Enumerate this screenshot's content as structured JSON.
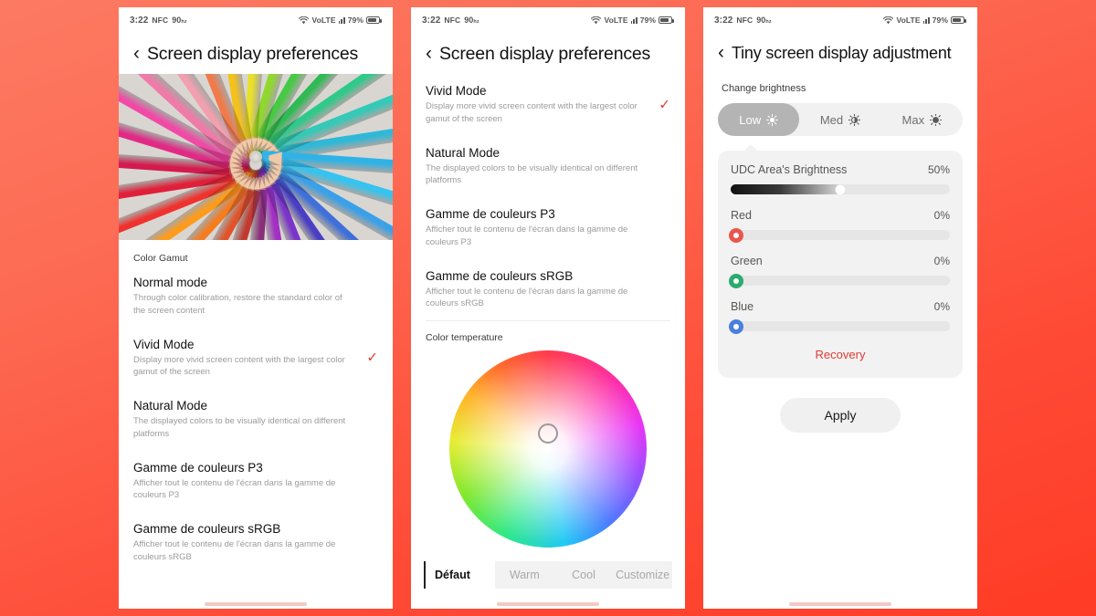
{
  "background": {
    "from": "#fd7a62",
    "to": "#ff3b25"
  },
  "accent": {
    "red": "#e23b34",
    "check": "#e23b34"
  },
  "status_bar": {
    "time": "3:22",
    "nfc": "NFC",
    "refresh_rate": "90",
    "refresh_unit": "hz",
    "wifi_icon": "wifi-icon",
    "volte": "VoLTE",
    "signal_icon": "signal-bars-icon",
    "battery_percent": "79%",
    "battery_icon": "battery-icon"
  },
  "panel1": {
    "back_icon": "back-chevron-icon",
    "title": "Screen display preferences",
    "hero_alt": "colored-pencils-radial-image",
    "section_label": "Color Gamut",
    "options": [
      {
        "title": "Normal mode",
        "sub": "Through color calibration, restore the standard color of the screen content",
        "checked": false
      },
      {
        "title": "Vivid Mode",
        "sub": "Display more vivid screen content with the largest color gamut of the screen",
        "checked": true
      },
      {
        "title": "Natural Mode",
        "sub": "The displayed colors to be visually identical on different platforms",
        "checked": false
      },
      {
        "title": "Gamme de couleurs P3",
        "sub": "Afficher tout le contenu de l'écran dans la gamme de couleurs P3",
        "checked": false
      },
      {
        "title": "Gamme de couleurs sRGB",
        "sub": "Afficher tout le contenu de l'écran dans la gamme de couleurs sRGB",
        "checked": false
      }
    ],
    "check_mark": "✓"
  },
  "panel2": {
    "back_icon": "back-chevron-icon",
    "title": "Screen display preferences",
    "options": [
      {
        "title": "Vivid Mode",
        "sub": "Display more vivid screen content with the largest color gamut of the screen",
        "checked": true
      },
      {
        "title": "Natural Mode",
        "sub": "The displayed colors to be visually identical on different platforms",
        "checked": false
      },
      {
        "title": "Gamme de couleurs P3",
        "sub": "Afficher tout le contenu de l'écran dans la gamme de couleurs P3",
        "checked": false
      },
      {
        "title": "Gamme de couleurs sRGB",
        "sub": "Afficher tout le contenu de l'écran dans la gamme de couleurs sRGB",
        "checked": false
      }
    ],
    "check_mark": "✓",
    "color_temperature_label": "Color temperature",
    "wheel_name": "color-temperature-wheel",
    "tabs": [
      {
        "label": "Défaut",
        "active": true
      },
      {
        "label": "Warm",
        "active": false
      },
      {
        "label": "Cool",
        "active": false
      },
      {
        "label": "Customize",
        "active": false
      }
    ]
  },
  "panel3": {
    "back_icon": "back-chevron-icon",
    "title": "Tiny screen display adjustment",
    "brightness_label": "Change brightness",
    "brightness_modes": [
      {
        "label": "Low",
        "icon": "sun-low-icon",
        "active": true
      },
      {
        "label": "Med",
        "icon": "sun-med-icon",
        "active": false
      },
      {
        "label": "Max",
        "icon": "sun-max-icon",
        "active": false
      }
    ],
    "sliders": [
      {
        "name": "UDC Area's Brightness",
        "value": "50%",
        "percent": 50,
        "type": "gradient",
        "color": "#1a1a1a"
      },
      {
        "name": "Red",
        "value": "0%",
        "percent": 0,
        "type": "dot",
        "color": "#e9564f"
      },
      {
        "name": "Green",
        "value": "0%",
        "percent": 0,
        "type": "dot",
        "color": "#2aab70"
      },
      {
        "name": "Blue",
        "value": "0%",
        "percent": 0,
        "type": "dot",
        "color": "#4a7fdb"
      }
    ],
    "recovery_label": "Recovery",
    "apply_label": "Apply"
  }
}
